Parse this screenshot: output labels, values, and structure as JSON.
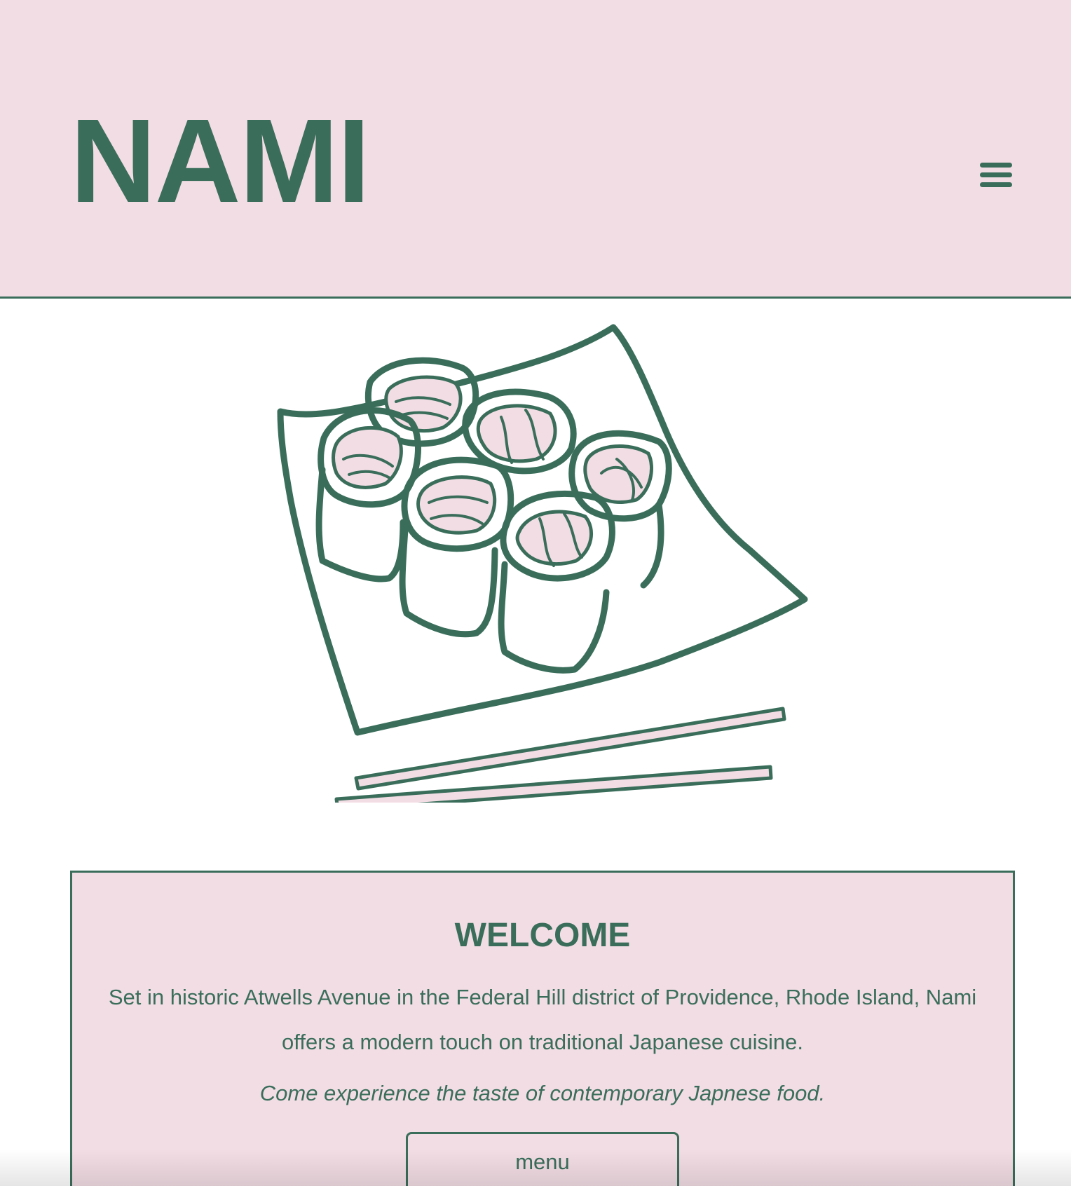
{
  "header": {
    "logo": "NAMI",
    "menu_icon": "hamburger-menu-icon"
  },
  "hero": {
    "illustration": "sushi-plate-illustration"
  },
  "welcome": {
    "title": "WELCOME",
    "description": "Set in historic Atwells Avenue in the Federal Hill district of Providence, Rhode Island, Nami offers a modern touch on traditional Japanese cuisine.",
    "tagline": "Come experience the taste of contemporary Japnese food.",
    "button_label": "menu"
  },
  "colors": {
    "primary_green": "#3a6e5b",
    "pink_background": "#f3dde5",
    "white": "#ffffff"
  }
}
